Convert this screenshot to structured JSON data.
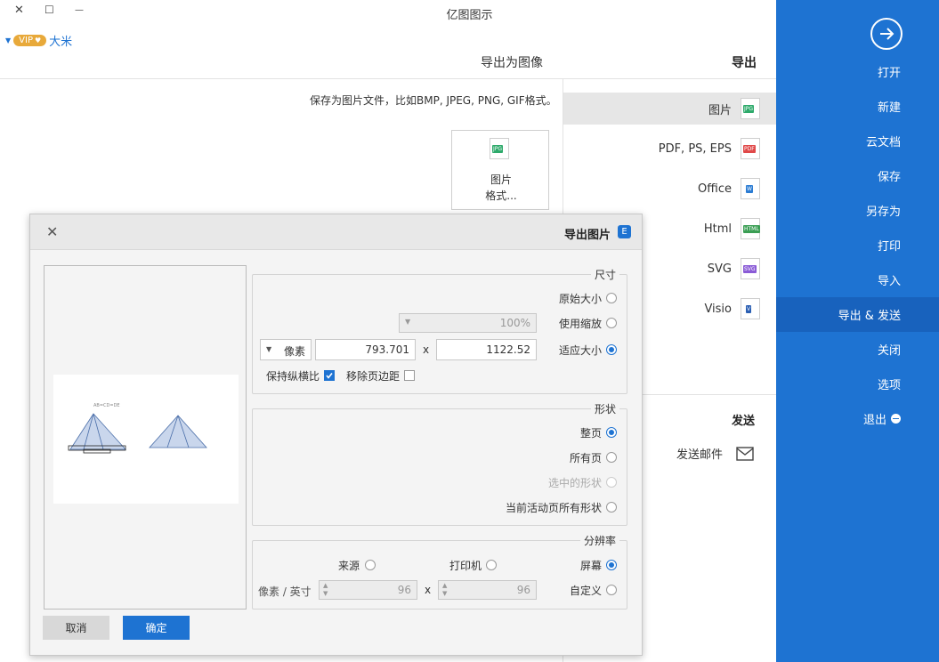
{
  "window": {
    "title": "亿图图示",
    "close_glyph": "✕",
    "maximize_glyph": "☐",
    "minimize_glyph": "—"
  },
  "account": {
    "name": "大米",
    "badge": "VIP"
  },
  "sidebar": {
    "items": [
      {
        "label": "打开"
      },
      {
        "label": "新建"
      },
      {
        "label": "云文档"
      },
      {
        "label": "保存"
      },
      {
        "label": "另存为"
      },
      {
        "label": "打印"
      },
      {
        "label": "导入"
      },
      {
        "label": "导出 & 发送"
      },
      {
        "label": "关闭"
      },
      {
        "label": "选项"
      },
      {
        "label": "退出"
      }
    ],
    "active_index": 7,
    "color": "#1e73d2"
  },
  "export_panel": {
    "heading": "导出",
    "items": [
      {
        "label": "图片",
        "icon": "jpg-file-icon",
        "tag": "JPG",
        "tag_color": "#2eaa6b"
      },
      {
        "label": "PDF, PS, EPS",
        "icon": "pdf-file-icon",
        "tag": "PDF",
        "tag_color": "#e04848"
      },
      {
        "label": "Office",
        "icon": "word-file-icon",
        "tag": "W",
        "tag_color": "#2b7cd3"
      },
      {
        "label": "Html",
        "icon": "html-file-icon",
        "tag": "HTML",
        "tag_color": "#3b9e54"
      },
      {
        "label": "SVG",
        "icon": "svg-file-icon",
        "tag": "SVG",
        "tag_color": "#8a5bd6"
      },
      {
        "label": "Visio",
        "icon": "visio-file-icon",
        "tag": "V",
        "tag_color": "#2b5fb3"
      }
    ],
    "send_heading": "发送",
    "send_items": [
      {
        "label": "发送邮件",
        "icon": "mail-icon"
      }
    ]
  },
  "main": {
    "heading": "导出为图像",
    "description": "保存为图片文件，比如BMP, JPEG, PNG, GIF格式。",
    "card_tag": "JPG",
    "card_line1": "图片",
    "card_line2": "格式..."
  },
  "dialog": {
    "title": "导出图片",
    "size": {
      "title": "尺寸",
      "original": "原始大小",
      "use_zoom": "使用缩放",
      "zoom_value": "100%",
      "fit": "适应大小",
      "width": "1122.52",
      "times": "x",
      "height": "793.701",
      "unit": "像素",
      "keep_ratio": "保持纵横比",
      "remove_margin": "移除页边距"
    },
    "shape": {
      "title": "形状",
      "whole_page": "整页",
      "all_pages": "所有页",
      "selected": "选中的形状",
      "current_page_all": "当前活动页所有形状"
    },
    "resolution": {
      "title": "分辨率",
      "screen": "屏幕",
      "printer": "打印机",
      "source": "来源",
      "custom": "自定义",
      "dpi_x": "96",
      "times": "x",
      "dpi_y": "96",
      "unit": "像素 / 英寸"
    },
    "ok": "确定",
    "cancel": "取消",
    "preview_label": "AB=CD=DE"
  }
}
